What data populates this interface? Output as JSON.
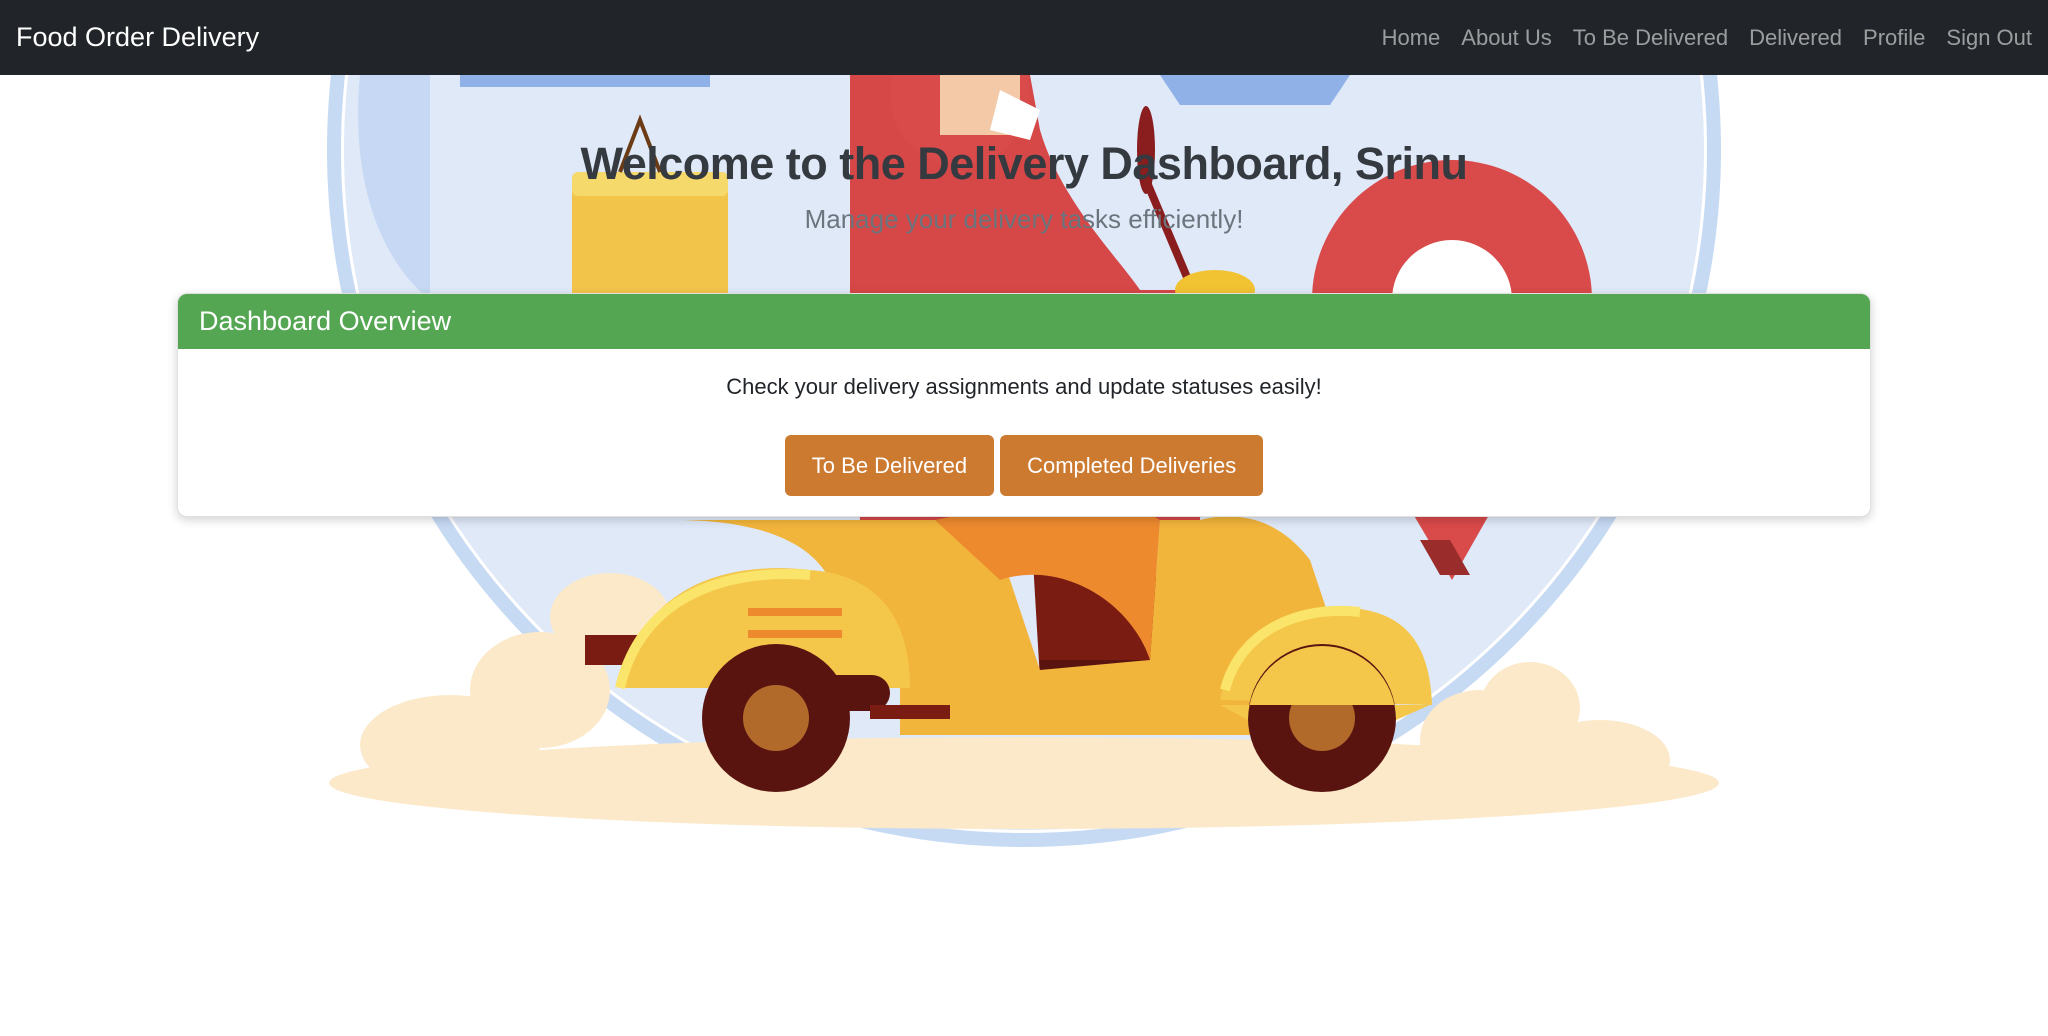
{
  "navbar": {
    "brand": "Food Order Delivery",
    "links": [
      "Home",
      "About Us",
      "To Be Delivered",
      "Delivered",
      "Profile",
      "Sign Out"
    ]
  },
  "hero": {
    "welcome": "Welcome to the Delivery Dashboard, Srinu",
    "subtitle": "Manage your delivery tasks efficiently!"
  },
  "card": {
    "header": "Dashboard Overview",
    "text": "Check your delivery assignments and update statuses easily!",
    "buttons": [
      "To Be Delivered",
      "Completed Deliveries"
    ]
  },
  "colors": {
    "navbar_bg": "#212529",
    "card_header": "#54a652",
    "button": "#cd7a31"
  }
}
